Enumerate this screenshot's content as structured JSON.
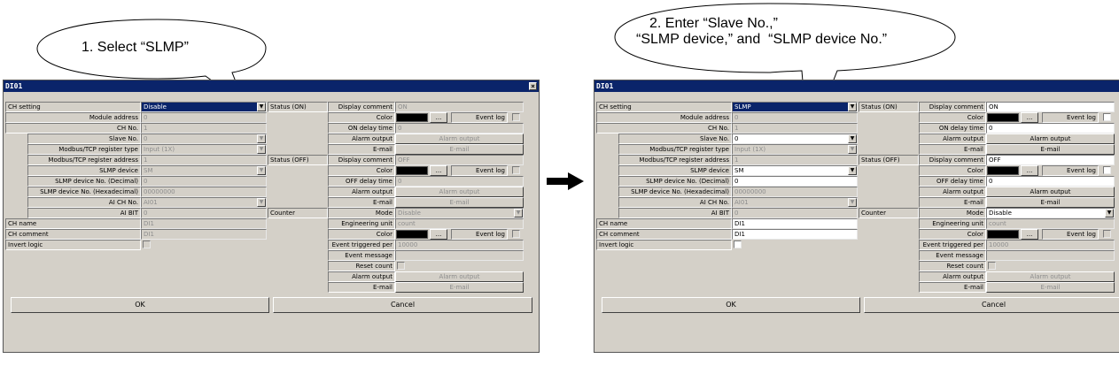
{
  "callouts": {
    "left": "1. Select “SLMP”",
    "right_line1": "2. Enter “Slave No.,”",
    "right_line2": "“SLMP device,” and  “SLMP device No.”"
  },
  "arrow_icon": "right-arrow-icon",
  "left": {
    "title": "DI01",
    "close": "×",
    "ch_setting_label": "CH setting",
    "ch_setting_value": "Disable",
    "module_address_label": "Module address",
    "module_address_value": "0",
    "ch_no_label": "CH No.",
    "ch_no_value": "1",
    "slave_no_label": "Slave No.",
    "slave_no_value": "0",
    "modbus_reg_type_label": "Modbus/TCP register type",
    "modbus_reg_type_value": "Input (1X)",
    "modbus_reg_addr_label": "Modbus/TCP register address",
    "modbus_reg_addr_value": "1",
    "slmp_device_label": "SLMP device",
    "slmp_device_value": "SM",
    "slmp_dec_label": "SLMP device No. (Decimal)",
    "slmp_dec_value": "0",
    "slmp_hex_label": "SLMP device No. (Hexadecimal)",
    "slmp_hex_value": "00000000",
    "ai_ch_label": "AI CH No.",
    "ai_ch_value": "AI01",
    "ai_bit_label": "AI BIT",
    "ai_bit_value": "0",
    "ch_name_label": "CH name",
    "ch_name_value": "DI1",
    "ch_comment_label": "CH comment",
    "ch_comment_value": "DI1",
    "invert_label": "Invert logic",
    "status_on_label": "Status (ON)",
    "status_off_label": "Status (OFF)",
    "counter_label": "Counter",
    "display_comment_label": "Display comment",
    "on_comment_value": "ON",
    "off_comment_value": "OFF",
    "color_label": "Color",
    "ellipsis": "...",
    "event_log_label": "Event log",
    "on_delay_label": "ON delay time",
    "on_delay_value": "0",
    "off_delay_label": "OFF delay time",
    "off_delay_value": "0",
    "alarm_output_label": "Alarm output",
    "alarm_output_button": "Alarm output",
    "email_label": "E-mail",
    "email_button": "E-mail",
    "mode_label": "Mode",
    "mode_value": "Disable",
    "eng_unit_label": "Engineering unit",
    "eng_unit_value": "count",
    "event_triggered_label": "Event triggered per",
    "event_triggered_value": "10000",
    "event_message_label": "Event message",
    "reset_count_label": "Reset count",
    "ok_button": "OK",
    "cancel_button": "Cancel"
  },
  "right": {
    "title": "DI01",
    "close": "×",
    "ch_setting_label": "CH setting",
    "ch_setting_value": "SLMP",
    "module_address_label": "Module address",
    "module_address_value": "0",
    "ch_no_label": "CH No.",
    "ch_no_value": "1",
    "slave_no_label": "Slave No.",
    "slave_no_value": "0",
    "modbus_reg_type_label": "Modbus/TCP register type",
    "modbus_reg_type_value": "Input (1X)",
    "modbus_reg_addr_label": "Modbus/TCP register address",
    "modbus_reg_addr_value": "1",
    "slmp_device_label": "SLMP device",
    "slmp_device_value": "SM",
    "slmp_dec_label": "SLMP device No. (Decimal)",
    "slmp_dec_value": "0",
    "slmp_hex_label": "SLMP device No. (Hexadecimal)",
    "slmp_hex_value": "00000000",
    "ai_ch_label": "AI CH No.",
    "ai_ch_value": "AI01",
    "ai_bit_label": "AI BIT",
    "ai_bit_value": "0",
    "ch_name_label": "CH name",
    "ch_name_value": "DI1",
    "ch_comment_label": "CH comment",
    "ch_comment_value": "DI1",
    "invert_label": "Invert logic",
    "status_on_label": "Status (ON)",
    "status_off_label": "Status (OFF)",
    "counter_label": "Counter",
    "display_comment_label": "Display comment",
    "on_comment_value": "ON",
    "off_comment_value": "OFF",
    "color_label": "Color",
    "ellipsis": "...",
    "event_log_label": "Event log",
    "on_delay_label": "ON delay time",
    "on_delay_value": "0",
    "off_delay_label": "OFF delay time",
    "off_delay_value": "0",
    "alarm_output_label": "Alarm output",
    "alarm_output_button": "Alarm output",
    "email_label": "E-mail",
    "email_button": "E-mail",
    "mode_label": "Mode",
    "mode_value": "Disable",
    "eng_unit_label": "Engineering unit",
    "eng_unit_value": "count",
    "event_triggered_label": "Event triggered per",
    "event_triggered_value": "10000",
    "event_message_label": "Event message",
    "reset_count_label": "Reset count",
    "ok_button": "OK",
    "cancel_button": "Cancel"
  }
}
